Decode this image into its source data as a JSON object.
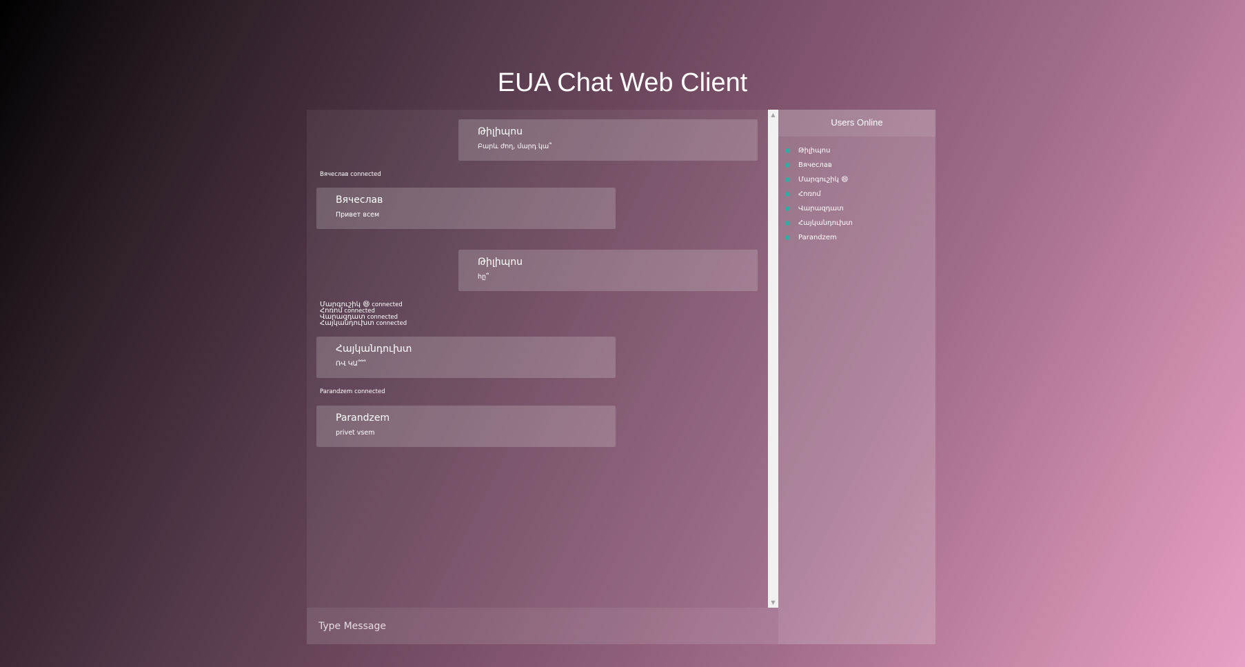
{
  "app": {
    "title": "EUA Chat Web Client"
  },
  "messages": [
    {
      "type": "message",
      "side": "right",
      "user": "Թիլիպոս",
      "text": "Բարև ժող, մարդ կա՞"
    },
    {
      "type": "system",
      "user": "Вячеслав",
      "text": "connected"
    },
    {
      "type": "message",
      "side": "left",
      "user": "Вячеслав",
      "text": "Привет всем"
    },
    {
      "type": "message",
      "side": "right",
      "user": "Թիլիպոս",
      "text": "hը՞"
    },
    {
      "type": "system",
      "user": "Մարգուշիկ 😄",
      "text": "connected"
    },
    {
      "type": "system",
      "user": "Հոռոմ",
      "text": "connected"
    },
    {
      "type": "system",
      "user": "Վարազդատ",
      "text": "connected"
    },
    {
      "type": "system",
      "user": "Հայկանդուխտ",
      "text": "connected"
    },
    {
      "type": "message",
      "side": "left",
      "user": "Հայկանդուխտ",
      "text": "ՌՎ ԿԱ՞՞՞"
    },
    {
      "type": "system",
      "user": "Parandzem",
      "text": "connected"
    },
    {
      "type": "message",
      "side": "left",
      "user": "Parandzem",
      "text": "privet vsem"
    }
  ],
  "input": {
    "placeholder": "Type Message"
  },
  "users_panel": {
    "title": "Users Online",
    "users": [
      "Թիլիպոս",
      "Вячеслав",
      "Մարգուշիկ 😄",
      "Հոռոմ",
      "Վարազդատ",
      "Հայկանդուխտ",
      "Parandzem"
    ]
  },
  "colors": {
    "online_dot": "#3aa7a3",
    "gradient_start": "#000000",
    "gradient_end": "#e8a0c6"
  },
  "icons": {
    "scroll_up": "scroll-up-arrow-icon",
    "scroll_down": "scroll-down-arrow-icon",
    "online_indicator": "online-dot-icon"
  }
}
